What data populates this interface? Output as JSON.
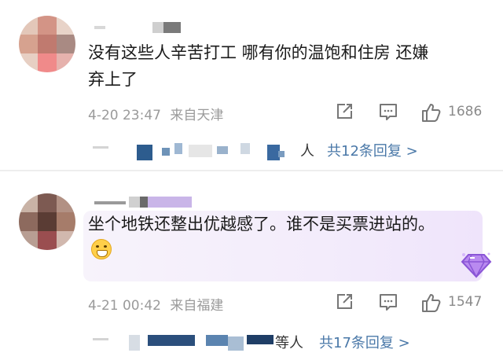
{
  "comments": [
    {
      "text": "没有这些人辛苦打工 哪有你的温饱和住房 还嫌弃上了",
      "time": "4-20 23:47",
      "source": "来自天津",
      "likes": "1686",
      "reply_suffix": "人",
      "reply_link": "共12条回复 >"
    },
    {
      "text": "坐个地铁还整出优越感了。谁不是买票进站的。",
      "time": "4-21 00:42",
      "source": "来自福建",
      "likes": "1547",
      "reply_suffix": "等人",
      "reply_link": "共17条回复 >"
    }
  ],
  "icons": {
    "share": "share-icon",
    "comment": "comment-icon",
    "like": "thumbs-up-icon",
    "badge": "diamond-badge-icon",
    "emoji": "grimacing-face-emoji"
  },
  "colors": {
    "reply_link": "#4a78a8",
    "meta_text": "#9a9a9a",
    "bubble_tint": "#f3ecfb"
  }
}
